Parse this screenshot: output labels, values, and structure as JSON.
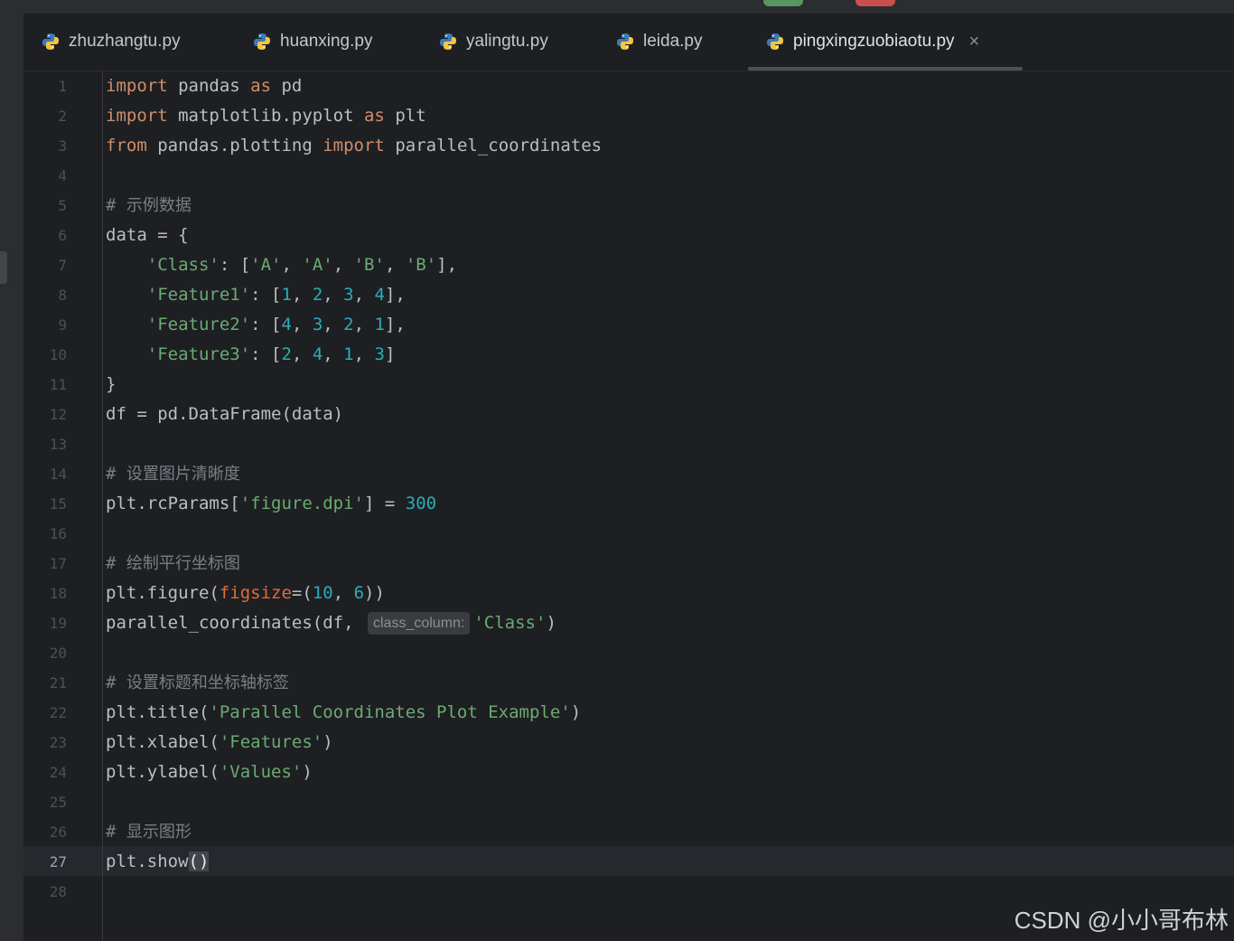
{
  "colors": {
    "background": "#1e1f22",
    "keyword": "#cf8e6d",
    "string": "#6aab73",
    "number": "#2aacb8",
    "comment": "#7a7e85",
    "parameter": "#e06c3a",
    "text": "#bcbec4"
  },
  "tabs": [
    {
      "label": "zhuzhangtu.py",
      "icon": "python-file-icon",
      "active": false
    },
    {
      "label": "huanxing.py",
      "icon": "python-file-icon",
      "active": false
    },
    {
      "label": "yalingtu.py",
      "icon": "python-file-icon",
      "active": false
    },
    {
      "label": "leida.py",
      "icon": "python-file-icon",
      "active": false
    },
    {
      "label": "pingxingzuobiaotu.py",
      "icon": "python-file-icon",
      "active": true,
      "close": "×"
    }
  ],
  "editor": {
    "current_line": 27,
    "line_numbers": [
      "1",
      "2",
      "3",
      "4",
      "5",
      "6",
      "7",
      "8",
      "9",
      "10",
      "11",
      "12",
      "13",
      "14",
      "15",
      "16",
      "17",
      "18",
      "19",
      "20",
      "21",
      "22",
      "23",
      "24",
      "25",
      "26",
      "27",
      "28"
    ],
    "inlay_hint": "class_column:",
    "lines": [
      [
        {
          "t": "kw",
          "v": "import"
        },
        {
          "t": "tx",
          "v": " pandas "
        },
        {
          "t": "kw",
          "v": "as"
        },
        {
          "t": "tx",
          "v": " pd"
        }
      ],
      [
        {
          "t": "kw",
          "v": "import"
        },
        {
          "t": "tx",
          "v": " matplotlib.pyplot "
        },
        {
          "t": "kw",
          "v": "as"
        },
        {
          "t": "tx",
          "v": " plt"
        }
      ],
      [
        {
          "t": "kw",
          "v": "from"
        },
        {
          "t": "tx",
          "v": " pandas.plotting "
        },
        {
          "t": "kw",
          "v": "import"
        },
        {
          "t": "tx",
          "v": " parallel_coordinates"
        }
      ],
      [],
      [
        {
          "t": "cm",
          "v": "# "
        },
        {
          "t": "cmtext",
          "v": "示例数据"
        }
      ],
      [
        {
          "t": "tx",
          "v": "data = {"
        }
      ],
      [
        {
          "t": "tx",
          "v": "    "
        },
        {
          "t": "str",
          "v": "'Class'"
        },
        {
          "t": "tx",
          "v": ": ["
        },
        {
          "t": "str",
          "v": "'A'"
        },
        {
          "t": "tx",
          "v": ", "
        },
        {
          "t": "str",
          "v": "'A'"
        },
        {
          "t": "tx",
          "v": ", "
        },
        {
          "t": "str",
          "v": "'B'"
        },
        {
          "t": "tx",
          "v": ", "
        },
        {
          "t": "str",
          "v": "'B'"
        },
        {
          "t": "tx",
          "v": "],"
        }
      ],
      [
        {
          "t": "tx",
          "v": "    "
        },
        {
          "t": "str",
          "v": "'Feature1'"
        },
        {
          "t": "tx",
          "v": ": ["
        },
        {
          "t": "num",
          "v": "1"
        },
        {
          "t": "tx",
          "v": ", "
        },
        {
          "t": "num",
          "v": "2"
        },
        {
          "t": "tx",
          "v": ", "
        },
        {
          "t": "num",
          "v": "3"
        },
        {
          "t": "tx",
          "v": ", "
        },
        {
          "t": "num",
          "v": "4"
        },
        {
          "t": "tx",
          "v": "],"
        }
      ],
      [
        {
          "t": "tx",
          "v": "    "
        },
        {
          "t": "str",
          "v": "'Feature2'"
        },
        {
          "t": "tx",
          "v": ": ["
        },
        {
          "t": "num",
          "v": "4"
        },
        {
          "t": "tx",
          "v": ", "
        },
        {
          "t": "num",
          "v": "3"
        },
        {
          "t": "tx",
          "v": ", "
        },
        {
          "t": "num",
          "v": "2"
        },
        {
          "t": "tx",
          "v": ", "
        },
        {
          "t": "num",
          "v": "1"
        },
        {
          "t": "tx",
          "v": "],"
        }
      ],
      [
        {
          "t": "tx",
          "v": "    "
        },
        {
          "t": "str",
          "v": "'Feature3'"
        },
        {
          "t": "tx",
          "v": ": ["
        },
        {
          "t": "num",
          "v": "2"
        },
        {
          "t": "tx",
          "v": ", "
        },
        {
          "t": "num",
          "v": "4"
        },
        {
          "t": "tx",
          "v": ", "
        },
        {
          "t": "num",
          "v": "1"
        },
        {
          "t": "tx",
          "v": ", "
        },
        {
          "t": "num",
          "v": "3"
        },
        {
          "t": "tx",
          "v": "]"
        }
      ],
      [
        {
          "t": "tx",
          "v": "}"
        }
      ],
      [
        {
          "t": "tx",
          "v": "df = pd.DataFrame(data)"
        }
      ],
      [],
      [
        {
          "t": "cm",
          "v": "# "
        },
        {
          "t": "cmtext",
          "v": "设置图片清晰度"
        }
      ],
      [
        {
          "t": "tx",
          "v": "plt.rcParams["
        },
        {
          "t": "str",
          "v": "'figure.dpi'"
        },
        {
          "t": "tx",
          "v": "] = "
        },
        {
          "t": "num",
          "v": "300"
        }
      ],
      [],
      [
        {
          "t": "cm",
          "v": "# "
        },
        {
          "t": "cmtext",
          "v": "绘制平行坐标图"
        }
      ],
      [
        {
          "t": "tx",
          "v": "plt.figure("
        },
        {
          "t": "param",
          "v": "figsize"
        },
        {
          "t": "tx",
          "v": "=("
        },
        {
          "t": "num",
          "v": "10"
        },
        {
          "t": "tx",
          "v": ", "
        },
        {
          "t": "num",
          "v": "6"
        },
        {
          "t": "tx",
          "v": "))"
        }
      ],
      [
        {
          "t": "tx",
          "v": "parallel_coordinates(df, "
        },
        {
          "t": "hint",
          "v": "class_column:"
        },
        {
          "t": "str",
          "v": "'Class'"
        },
        {
          "t": "tx",
          "v": ")"
        }
      ],
      [],
      [
        {
          "t": "cm",
          "v": "# "
        },
        {
          "t": "cmtext",
          "v": "设置标题和坐标轴标签"
        }
      ],
      [
        {
          "t": "tx",
          "v": "plt.title("
        },
        {
          "t": "str",
          "v": "'Parallel Coordinates Plot Example'"
        },
        {
          "t": "tx",
          "v": ")"
        }
      ],
      [
        {
          "t": "tx",
          "v": "plt.xlabel("
        },
        {
          "t": "str",
          "v": "'Features'"
        },
        {
          "t": "tx",
          "v": ")"
        }
      ],
      [
        {
          "t": "tx",
          "v": "plt.ylabel("
        },
        {
          "t": "str",
          "v": "'Values'"
        },
        {
          "t": "tx",
          "v": ")"
        }
      ],
      [],
      [
        {
          "t": "cm",
          "v": "# "
        },
        {
          "t": "cmtext",
          "v": "显示图形"
        }
      ],
      [
        {
          "t": "tx",
          "v": "plt.show"
        },
        {
          "t": "br",
          "v": "()"
        }
      ],
      []
    ]
  },
  "watermark": "CSDN @小小哥布林"
}
